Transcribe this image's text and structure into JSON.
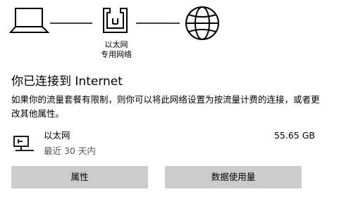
{
  "diagram": {
    "adapter_name": "以太网",
    "adapter_type": "专用网络",
    "icons": [
      "laptop-icon",
      "ethernet-port-icon",
      "globe-icon"
    ]
  },
  "status": {
    "title": "你已连接到 Internet",
    "description": "如果你的流量套餐有限制，则你可以将此网络设置为按流量计费的连接，或者更改其他属性。"
  },
  "usage": {
    "icon": "network-monitor-icon",
    "name": "以太网",
    "period": "最近 30 天内",
    "amount": "55.65 GB"
  },
  "buttons": {
    "properties": "属性",
    "data_usage": "数据使用量"
  },
  "colors": {
    "button_bg": "#cccccc",
    "text": "#000000",
    "secondary_text": "#555555"
  }
}
